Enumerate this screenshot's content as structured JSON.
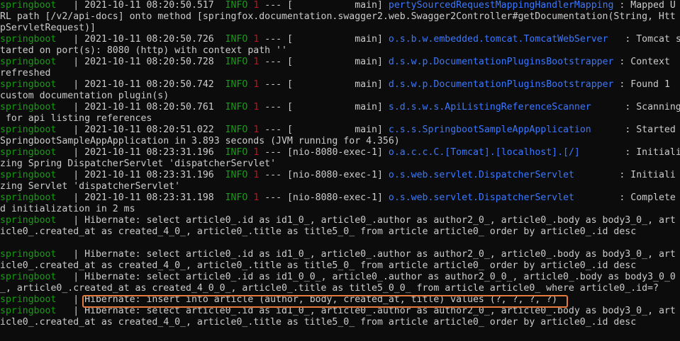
{
  "colors": {
    "background": "#0c0c0c",
    "text": "#cccccc",
    "service": "#13a10e",
    "level": "#13a10e",
    "pid": "#c50f1f",
    "logger": "#3b78ff",
    "highlight": "#e57a3a"
  },
  "lines": [
    {
      "svc": "springboot",
      "sep": "   | ",
      "ts": "2021-10-11 08:20:50.517",
      "lvl": "  INFO",
      "pid": " 1",
      "dash": " --- [",
      "thr": "           main] ",
      "cls": "pertySourcedRequestMappingHandlerMapping",
      "msg": " : Mapped U"
    },
    {
      "plain": "RL path [/v2/api-docs] onto method [springfox.documentation.swagger2.web.Swagger2Controller#getDocumentation(String, Htt"
    },
    {
      "plain": "pServletRequest)]"
    },
    {
      "svc": "springboot",
      "sep": "   | ",
      "ts": "2021-10-11 08:20:50.726",
      "lvl": "  INFO",
      "pid": " 1",
      "dash": " --- [",
      "thr": "           main] ",
      "cls": "o.s.b.w.embedded.tomcat.TomcatWebServer",
      "msg": "   : Tomcat s"
    },
    {
      "plain": "tarted on port(s): 8080 (http) with context path ''"
    },
    {
      "svc": "springboot",
      "sep": "   | ",
      "ts": "2021-10-11 08:20:50.728",
      "lvl": "  INFO",
      "pid": " 1",
      "dash": " --- [",
      "thr": "           main] ",
      "cls": "d.s.w.p.DocumentationPluginsBootstrapper",
      "msg": " : Context"
    },
    {
      "plain": "refreshed"
    },
    {
      "svc": "springboot",
      "sep": "   | ",
      "ts": "2021-10-11 08:20:50.742",
      "lvl": "  INFO",
      "pid": " 1",
      "dash": " --- [",
      "thr": "           main] ",
      "cls": "d.s.w.p.DocumentationPluginsBootstrapper",
      "msg": " : Found 1"
    },
    {
      "plain": "custom documentation plugin(s)"
    },
    {
      "svc": "springboot",
      "sep": "   | ",
      "ts": "2021-10-11 08:20:50.761",
      "lvl": "  INFO",
      "pid": " 1",
      "dash": " --- [",
      "thr": "           main] ",
      "cls": "s.d.s.w.s.ApiListingReferenceScanner",
      "msg": "      : Scanning"
    },
    {
      "plain": " for api listing references"
    },
    {
      "svc": "springboot",
      "sep": "   | ",
      "ts": "2021-10-11 08:20:51.022",
      "lvl": "  INFO",
      "pid": " 1",
      "dash": " --- [",
      "thr": "           main] ",
      "cls": "c.s.s.SpringbootSampleAppApplication",
      "msg": "      : Started"
    },
    {
      "plain": "SpringbootSampleAppApplication in 3.893 seconds (JVM running for 4.356)"
    },
    {
      "svc": "springboot",
      "sep": "   | ",
      "ts": "2021-10-11 08:23:31.196",
      "lvl": "  INFO",
      "pid": " 1",
      "dash": " --- [",
      "thr": "nio-8080-exec-1] ",
      "cls": "o.a.c.c.C.[Tomcat].[localhost].[/]",
      "msg": "        : Initiali"
    },
    {
      "plain": "zing Spring DispatcherServlet 'dispatcherServlet'"
    },
    {
      "svc": "springboot",
      "sep": "   | ",
      "ts": "2021-10-11 08:23:31.196",
      "lvl": "  INFO",
      "pid": " 1",
      "dash": " --- [",
      "thr": "nio-8080-exec-1] ",
      "cls": "o.s.web.servlet.DispatcherServlet",
      "msg": "        : Initiali"
    },
    {
      "plain": "zing Servlet 'dispatcherServlet'"
    },
    {
      "svc": "springboot",
      "sep": "   | ",
      "ts": "2021-10-11 08:23:31.198",
      "lvl": "  INFO",
      "pid": " 1",
      "dash": " --- [",
      "thr": "nio-8080-exec-1] ",
      "cls": "o.s.web.servlet.DispatcherServlet",
      "msg": "        : Complete"
    },
    {
      "plain": "d initialization in 2 ms"
    },
    {
      "svc": "springboot",
      "sep": "   | ",
      "msg": "Hibernate: select article0_.id as id1_0_, article0_.author as author2_0_, article0_.body as body3_0_, art"
    },
    {
      "plain": "icle0_.created_at as created_4_0_, article0_.title as title5_0_ from article article0_ order by article0_.id desc"
    },
    {
      "plain": ""
    },
    {
      "svc": "springboot",
      "sep": "   | ",
      "msg": "Hibernate: select article0_.id as id1_0_, article0_.author as author2_0_, article0_.body as body3_0_, art"
    },
    {
      "plain": "icle0_.created_at as created_4_0_, article0_.title as title5_0_ from article article0_ order by article0_.id desc"
    },
    {
      "svc": "springboot",
      "sep": "   | ",
      "msg": "Hibernate: select article0_.id as id1_0_0_, article0_.author as author2_0_0_, article0_.body as body3_0_0"
    },
    {
      "plain": "_, article0_.created_at as created_4_0_0_, article0_.title as title5_0_0_ from article article0_ where article0_.id=?"
    },
    {
      "svc": "springboot",
      "sep": "   | ",
      "msg": "Hibernate: insert into article (author, body, created_at, title) values (?, ?, ?, ?)"
    },
    {
      "svc": "springboot",
      "sep": "   | ",
      "msg": "Hibernate: select article0_.id as id1_0_, article0_.author as author2_0_, article0_.body as body3_0_, art"
    },
    {
      "plain": "icle0_.created_at as created_4_0_, article0_.title as title5_0_ from article article0_ order by article0_.id desc"
    }
  ]
}
